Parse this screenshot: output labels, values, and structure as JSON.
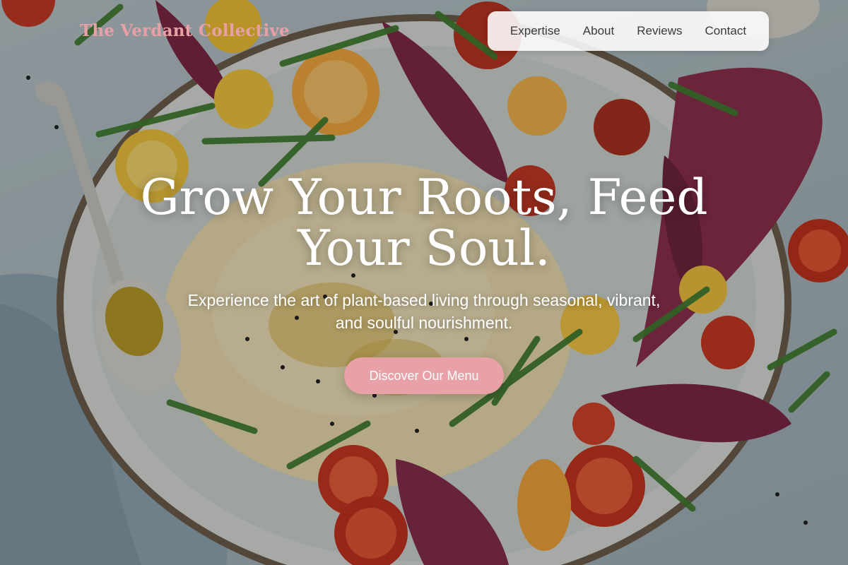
{
  "brand": {
    "name": "The Verdant Collective",
    "accent": "#e7a1a7"
  },
  "nav": {
    "items": [
      {
        "label": "Expertise"
      },
      {
        "label": "About"
      },
      {
        "label": "Reviews"
      },
      {
        "label": "Contact"
      }
    ]
  },
  "hero": {
    "title_line1": "Grow Your Roots, Feed",
    "title_line2": "Your Soul.",
    "subtitle_line1": "Experience the art of plant-based living through seasonal, vibrant,",
    "subtitle_line2": "and soulful nourishment.",
    "cta_label": "Discover Our Menu",
    "background_image": "hummus-salad-platter-photo"
  }
}
